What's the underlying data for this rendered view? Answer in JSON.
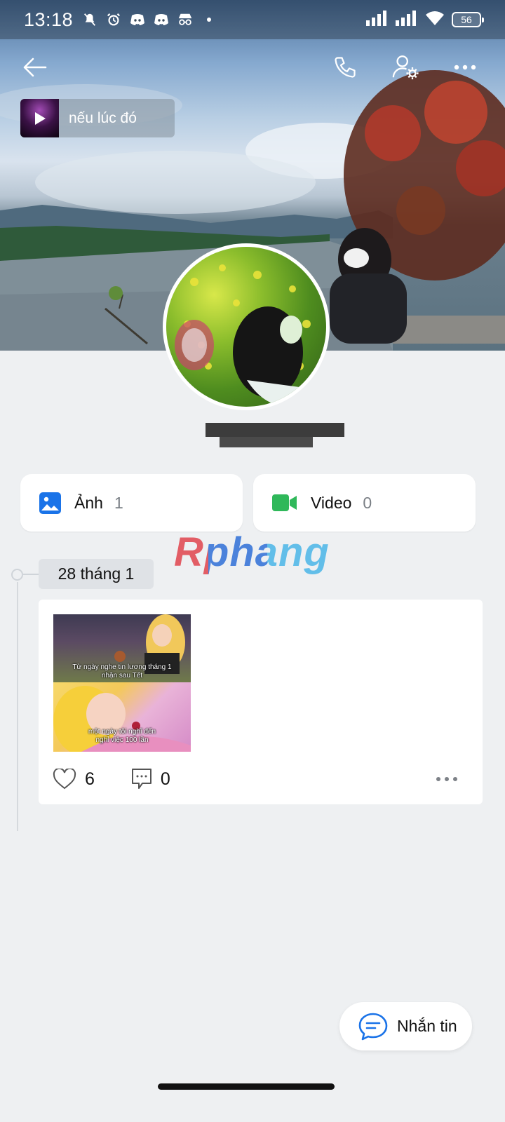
{
  "status_bar": {
    "time": "13:18",
    "battery": "56",
    "notification_icons": [
      "mute-bell-icon",
      "alarm-icon",
      "discord-icon",
      "discord-icon",
      "incognito-icon",
      "dot-icon"
    ]
  },
  "header": {
    "back_icon": "arrow-left-icon",
    "call_icon": "phone-icon",
    "settings_icon": "user-settings-icon",
    "more_icon": "more-horizontal-icon"
  },
  "music": {
    "title": "nếu lúc đó"
  },
  "profile": {
    "name": ""
  },
  "media": {
    "photos": {
      "label": "Ảnh",
      "count": "1",
      "color": "#1a73e8"
    },
    "videos": {
      "label": "Video",
      "count": "0",
      "color": "#2fb85a"
    }
  },
  "watermark": "Rphang",
  "timeline": {
    "date": "28 tháng 1",
    "post": {
      "caption_top": "Từ ngày nghe tin lương tháng 1\nnhận sau Tết",
      "caption_bottom": "một ngày tôi nghĩ đến\nnghỉ việc 100 lần",
      "likes": "6",
      "comments": "0"
    }
  },
  "message_button": {
    "label": "Nhắn tin",
    "accent": "#1a73e8"
  }
}
